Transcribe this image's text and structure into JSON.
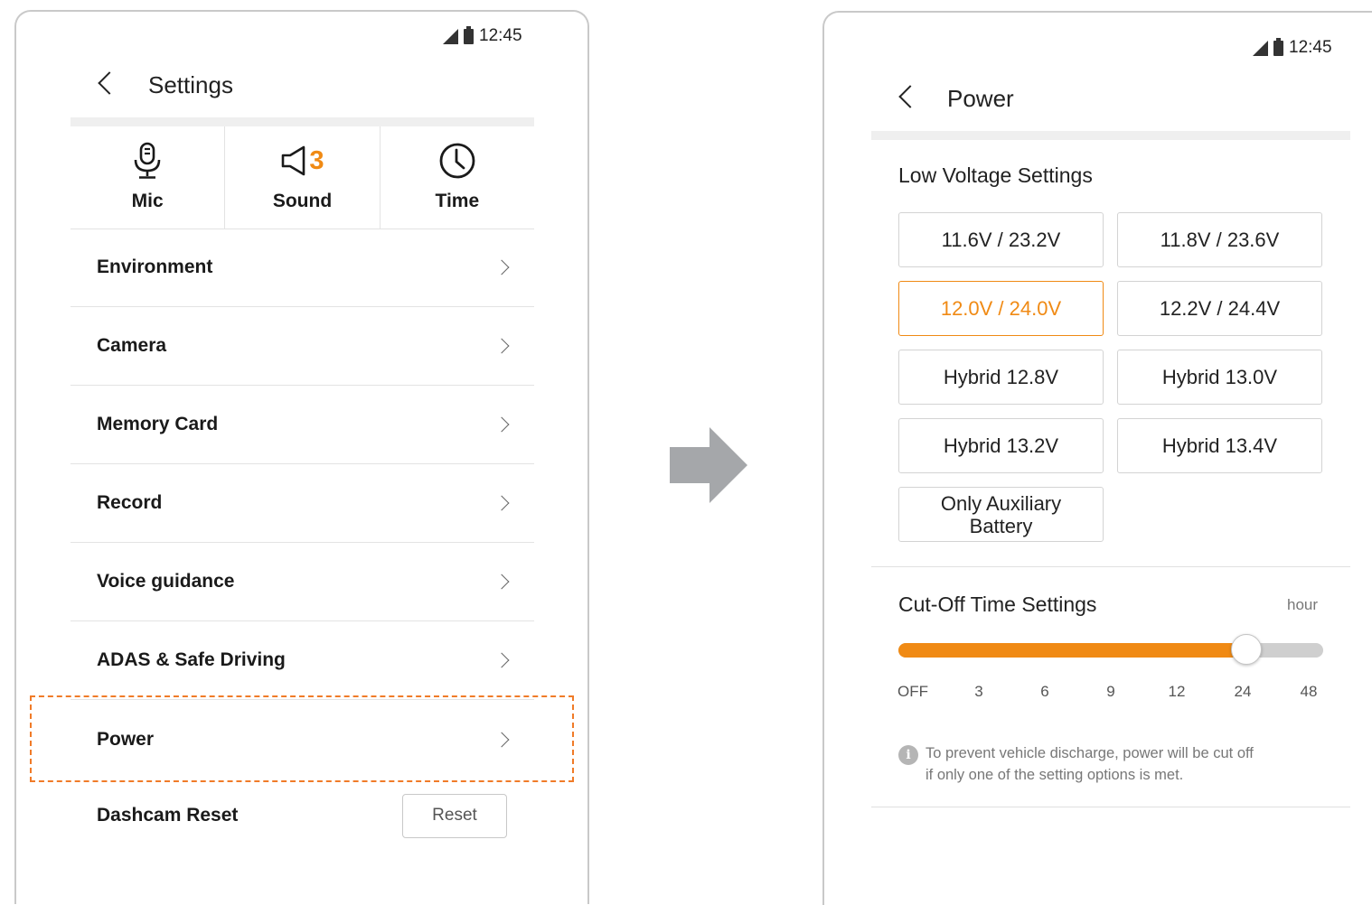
{
  "left_screen": {
    "status_time": "12:45",
    "title": "Settings",
    "quick": {
      "mic": "Mic",
      "sound": "Sound",
      "sound_count": "3",
      "time": "Time"
    },
    "menu": [
      {
        "label": "Environment"
      },
      {
        "label": "Camera"
      },
      {
        "label": "Memory Card"
      },
      {
        "label": "Record"
      },
      {
        "label": "Voice guidance"
      },
      {
        "label": "ADAS & Safe Driving"
      },
      {
        "label": "Power"
      }
    ],
    "reset_label": "Dashcam Reset",
    "reset_button": "Reset",
    "highlight_color": "#f07b28"
  },
  "right_screen": {
    "status_time": "12:45",
    "title": "Power",
    "low_voltage": {
      "title": "Low Voltage Settings",
      "options": [
        "11.6V / 23.2V",
        "11.8V / 23.6V",
        "12.0V / 24.0V",
        "12.2V / 24.4V",
        "Hybrid 12.8V",
        "Hybrid 13.0V",
        "Hybrid 13.2V",
        "Hybrid 13.4V",
        "Only Auxiliary Battery"
      ],
      "selected": "12.0V / 24.0V"
    },
    "cutoff": {
      "title": "Cut-Off Time Settings",
      "unit": "hour",
      "ticks": [
        "OFF",
        "3",
        "6",
        "9",
        "12",
        "24",
        "48"
      ],
      "selected": "24"
    },
    "info_icon": "i",
    "info_text_line1": "To prevent vehicle discharge, power will be cut off",
    "info_text_line2": "if only one of the setting options is met."
  },
  "colors": {
    "accent": "#f08a14",
    "arrow": "#a5a7aa"
  }
}
